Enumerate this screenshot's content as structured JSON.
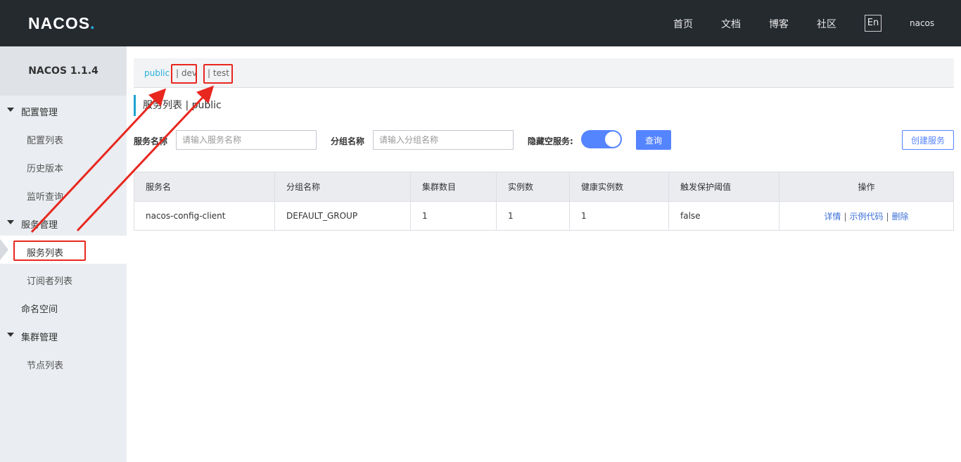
{
  "header": {
    "logo": "NACOS",
    "logo_dot": ".",
    "nav": [
      "首页",
      "文档",
      "博客",
      "社区"
    ],
    "lang": "En",
    "user": "nacos"
  },
  "sidebar": {
    "version": "NACOS 1.1.4",
    "groups": [
      {
        "label": "配置管理",
        "items": [
          "配置列表",
          "历史版本",
          "监听查询"
        ]
      },
      {
        "label": "服务管理",
        "items": [
          "服务列表",
          "订阅者列表"
        ]
      },
      {
        "label": "命名空间"
      },
      {
        "label": "集群管理",
        "items": [
          "节点列表"
        ]
      }
    ],
    "active_item": "服务列表"
  },
  "namespaces": [
    "public",
    "| dev",
    "| test"
  ],
  "page_title": "服务列表 | public",
  "filters": {
    "service_name_label": "服务名称",
    "service_name_placeholder": "请输入服务名称",
    "group_name_label": "分组名称",
    "group_name_placeholder": "请输入分组名称",
    "hide_empty_label": "隐藏空服务:",
    "hide_empty_on": true,
    "query_button": "查询",
    "create_button": "创建服务"
  },
  "table": {
    "columns": [
      "服务名",
      "分组名称",
      "集群数目",
      "实例数",
      "健康实例数",
      "触发保护阈值",
      "操作"
    ],
    "rows": [
      {
        "name": "nacos-config-client",
        "group": "DEFAULT_GROUP",
        "clusters": "1",
        "instances": "1",
        "healthy": "1",
        "threshold": "false"
      }
    ],
    "actions": [
      "详情",
      "示例代码",
      "删除"
    ],
    "action_sep": "|"
  },
  "annotation_color": "#e8271f"
}
